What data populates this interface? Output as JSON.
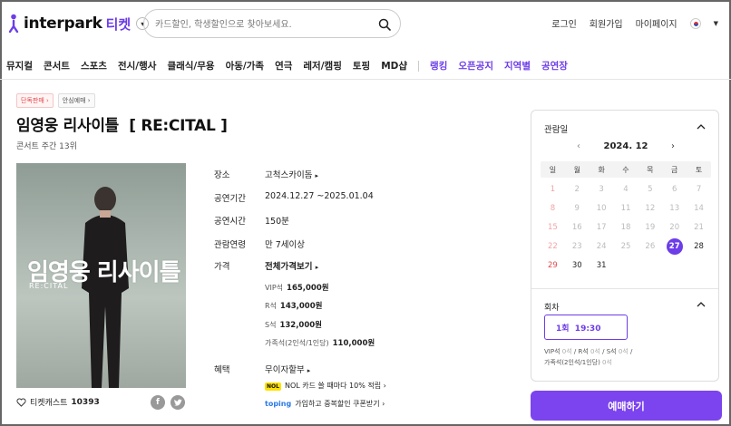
{
  "header": {
    "logo_text": "interpark",
    "logo_sub": "티켓",
    "search_placeholder": "카드할인, 학생할인으로 찾아보세요.",
    "links": [
      "로그인",
      "회원가입",
      "마이페이지"
    ]
  },
  "nav": {
    "items": [
      "뮤지컬",
      "콘서트",
      "스포츠",
      "전시/행사",
      "클래식/무용",
      "아동/가족",
      "연극",
      "레저/캠핑",
      "토핑",
      "MD샵"
    ],
    "highlight": [
      "랭킹",
      "오픈공지",
      "지역별",
      "공연장"
    ]
  },
  "badges": [
    "단독판매",
    "안심예매"
  ],
  "product": {
    "title": "임영웅 리사이틀  [ RE:CITAL ]",
    "subtitle": "콘서트 주간 13위"
  },
  "poster": {
    "title_ko": "임영웅 리사이틀",
    "title_en": "RE:CITAL"
  },
  "info": {
    "venue_label": "장소",
    "venue": "고척스카이돔",
    "period_label": "공연기간",
    "period": "2024.12.27 ~2025.01.04",
    "runtime_label": "공연시간",
    "runtime": "150분",
    "age_label": "관람연령",
    "age": "만 7세이상",
    "price_label": "가격",
    "price_all": "전체가격보기",
    "prices": [
      {
        "grade": "VIP석",
        "price": "165,000원"
      },
      {
        "grade": "R석",
        "price": "143,000원"
      },
      {
        "grade": "S석",
        "price": "132,000원"
      },
      {
        "grade": "가족석(2인석/1인당)",
        "price": "110,000원"
      }
    ],
    "benefit_label": "혜택",
    "benefit": "무이자할부",
    "benefit_nol": "NOL 카드 쓸 때마다 10% 적립",
    "benefit_nol_tag": "NOL",
    "benefit_toping_tag": "toping",
    "benefit_toping": "가입하고 중복할인 쿠폰받기"
  },
  "footer_left": {
    "cast_label": "티켓캐스트",
    "cast_count": "10393",
    "facebook": "f"
  },
  "calendar": {
    "label": "관람일",
    "month": "2024. 12",
    "weekdays": [
      "일",
      "월",
      "화",
      "수",
      "목",
      "금",
      "토"
    ],
    "days": [
      "1",
      "2",
      "3",
      "4",
      "5",
      "6",
      "7",
      "8",
      "9",
      "10",
      "11",
      "12",
      "13",
      "14",
      "15",
      "16",
      "17",
      "18",
      "19",
      "20",
      "21",
      "22",
      "23",
      "24",
      "25",
      "26",
      "27",
      "28",
      "29",
      "30",
      "31"
    ],
    "available_days": [
      27,
      28,
      29,
      30,
      31
    ],
    "selected_day": 27
  },
  "round": {
    "label": "회차",
    "selected": "1회  19:30",
    "seat_info": [
      {
        "grade": "VIP석",
        "count": "0석"
      },
      {
        "grade": "R석",
        "count": "0석"
      },
      {
        "grade": "S석",
        "count": "0석"
      },
      {
        "grade": "가족석(2인석/1인당)",
        "count": "0석"
      }
    ]
  },
  "book_button": "예매하기",
  "colors": {
    "accent": "#6c3de8",
    "button": "#7b44ee",
    "sunday": "#e5484d"
  }
}
